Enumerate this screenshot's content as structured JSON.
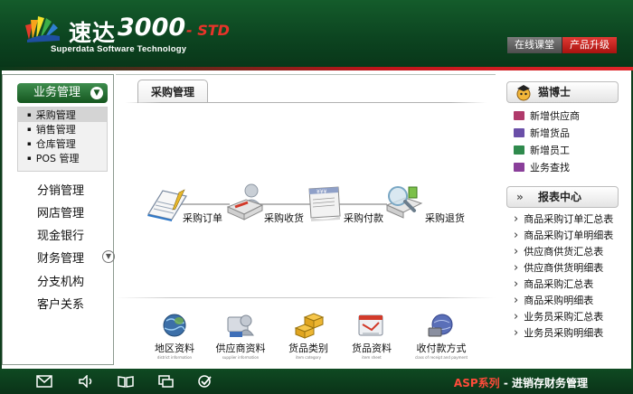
{
  "header": {
    "logo_cn": "速达",
    "logo_num": "3000",
    "logo_std": "- STD",
    "logo_en": "Superdata Software Technology",
    "buttons": [
      {
        "label": "在线课堂",
        "style": "gray"
      },
      {
        "label": "产品升级",
        "style": "red"
      }
    ]
  },
  "sidebar": {
    "business_button": "业务管理",
    "submenu": [
      {
        "label": "采购管理",
        "active": true
      },
      {
        "label": "销售管理",
        "active": false
      },
      {
        "label": "仓库管理",
        "active": false
      },
      {
        "label": "POS 管理",
        "active": false
      }
    ],
    "menu": [
      {
        "label": "分销管理"
      },
      {
        "label": "网店管理"
      },
      {
        "label": "现金银行"
      },
      {
        "label": "财务管理",
        "expandable": true
      },
      {
        "label": "分支机构"
      },
      {
        "label": "客户关系"
      }
    ]
  },
  "center": {
    "tab": "采购管理",
    "flow": [
      {
        "label": "采购订单",
        "icon": "notebook-icon"
      },
      {
        "label": "采购收货",
        "icon": "receive-goods-icon"
      },
      {
        "label": "采购付款",
        "icon": "payment-invoice-icon"
      },
      {
        "label": "采购退货",
        "icon": "return-magnifier-icon"
      }
    ],
    "quick": [
      {
        "label": "地区资料",
        "sub": "district information",
        "icon": "globe-icon"
      },
      {
        "label": "供应商资料",
        "sub": "supplier information",
        "icon": "supplier-icon"
      },
      {
        "label": "货品类别",
        "sub": "item category",
        "icon": "boxes-icon"
      },
      {
        "label": "货品资料",
        "sub": "item sheet",
        "icon": "item-sheet-icon"
      },
      {
        "label": "收付款方式",
        "sub": "class of receipt and payment",
        "icon": "payment-globe-icon"
      }
    ]
  },
  "right": {
    "expert_title": "猫博士",
    "expert_links": [
      {
        "label": "新增供应商",
        "color": "#b03a6b"
      },
      {
        "label": "新增货品",
        "color": "#6a4fa8"
      },
      {
        "label": "新增员工",
        "color": "#2f8a4d"
      },
      {
        "label": "业务查找",
        "color": "#8a3f9a"
      }
    ],
    "report_title": "报表中心",
    "report_links": [
      "商品采购订单汇总表",
      "商品采购订单明细表",
      "供应商供货汇总表",
      "供应商供货明细表",
      "商品采购汇总表",
      "商品采购明细表",
      "业务员采购汇总表",
      "业务员采购明细表"
    ]
  },
  "footer": {
    "brand_asp": "ASP系列",
    "brand_rest": " - 进销存财务管理",
    "icons": [
      "mail-icon",
      "speaker-icon",
      "book-icon",
      "window-icon",
      "check-icon"
    ]
  }
}
